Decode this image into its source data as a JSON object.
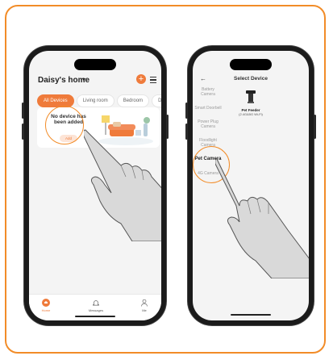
{
  "phone1": {
    "home_title": "Daisy's home",
    "add_symbol": "+",
    "tabs": [
      {
        "label": "All Devices",
        "active": true
      },
      {
        "label": "Living room",
        "active": false
      },
      {
        "label": "Bedroom",
        "active": false
      },
      {
        "label": "Doo",
        "active": false
      }
    ],
    "empty_message": "No device has been added",
    "add_button": "Add",
    "nav": [
      {
        "label": "Home",
        "icon": "home-icon",
        "active": true
      },
      {
        "label": "Messages",
        "icon": "bell-icon",
        "active": false
      },
      {
        "label": "Me",
        "icon": "person-icon",
        "active": false
      }
    ]
  },
  "phone2": {
    "title": "Select Device",
    "categories": [
      {
        "label": "Battery Camera",
        "active": false
      },
      {
        "label": "Smart Doorbell",
        "active": false
      },
      {
        "label": "Power Plug Camera",
        "active": false
      },
      {
        "label": "Floodlight Camera",
        "active": false
      },
      {
        "label": "Pet Camera",
        "active": true
      },
      {
        "label": "4G Camera",
        "active": false
      }
    ],
    "device": {
      "name": "Pet Feeder",
      "subtitle": "(2.4G&5G Wi-Fi)"
    }
  },
  "colors": {
    "accent": "#ef7b3b",
    "frame": "#f28c28"
  }
}
